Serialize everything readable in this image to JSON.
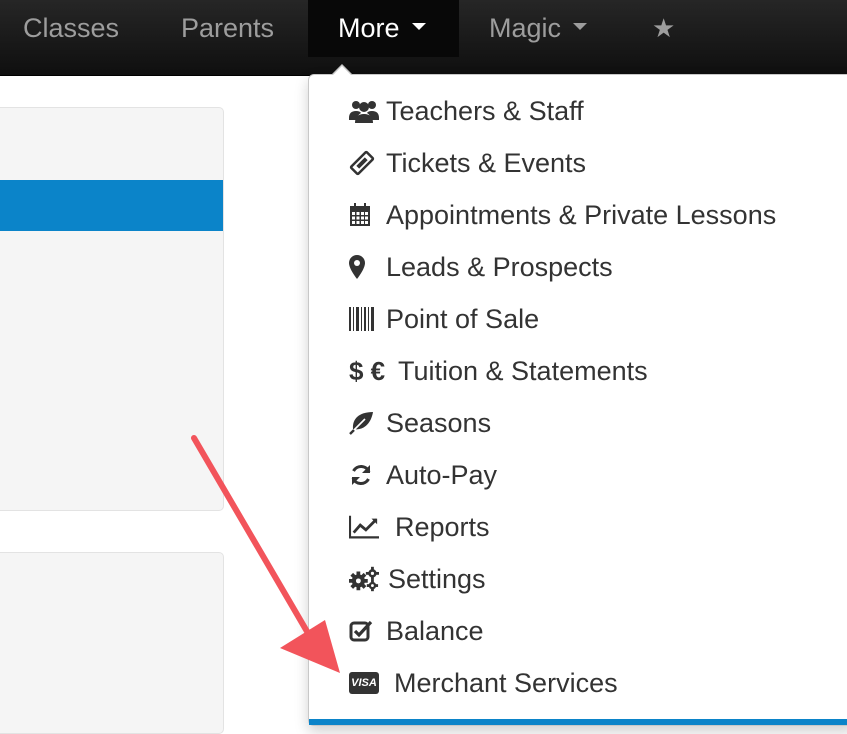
{
  "navbar": {
    "items": [
      {
        "label": "Classes"
      },
      {
        "label": "Parents"
      },
      {
        "label": "More"
      },
      {
        "label": "Magic"
      }
    ],
    "favorites_icon": "star-icon",
    "active_color": "#ffffff",
    "inactive_color": "#9d9d9d"
  },
  "dropdown": {
    "items": [
      {
        "label": "Teachers & Staff",
        "icon": "users-icon"
      },
      {
        "label": "Tickets & Events",
        "icon": "ticket-icon"
      },
      {
        "label": "Appointments & Private Lessons",
        "icon": "calendar-icon"
      },
      {
        "label": "Leads & Prospects",
        "icon": "map-marker-icon"
      },
      {
        "label": "Point of Sale",
        "icon": "barcode-icon"
      },
      {
        "label": "Tuition & Statements",
        "icon": "dollar-euro-icon",
        "icon_text": "$ €"
      },
      {
        "label": "Seasons",
        "icon": "leaf-icon"
      },
      {
        "label": "Auto-Pay",
        "icon": "refresh-icon"
      },
      {
        "label": "Reports",
        "icon": "line-chart-icon"
      },
      {
        "label": "Settings",
        "icon": "gears-icon"
      },
      {
        "label": "Balance",
        "icon": "check-square-icon"
      },
      {
        "label": "Merchant Services",
        "icon": "visa-card-icon",
        "icon_text": "VISA"
      }
    ]
  },
  "colors": {
    "navbar_bg": "#111111",
    "accent_blue": "#0b84c9",
    "annotation_arrow": "#f2545b",
    "menu_text": "#333333"
  }
}
